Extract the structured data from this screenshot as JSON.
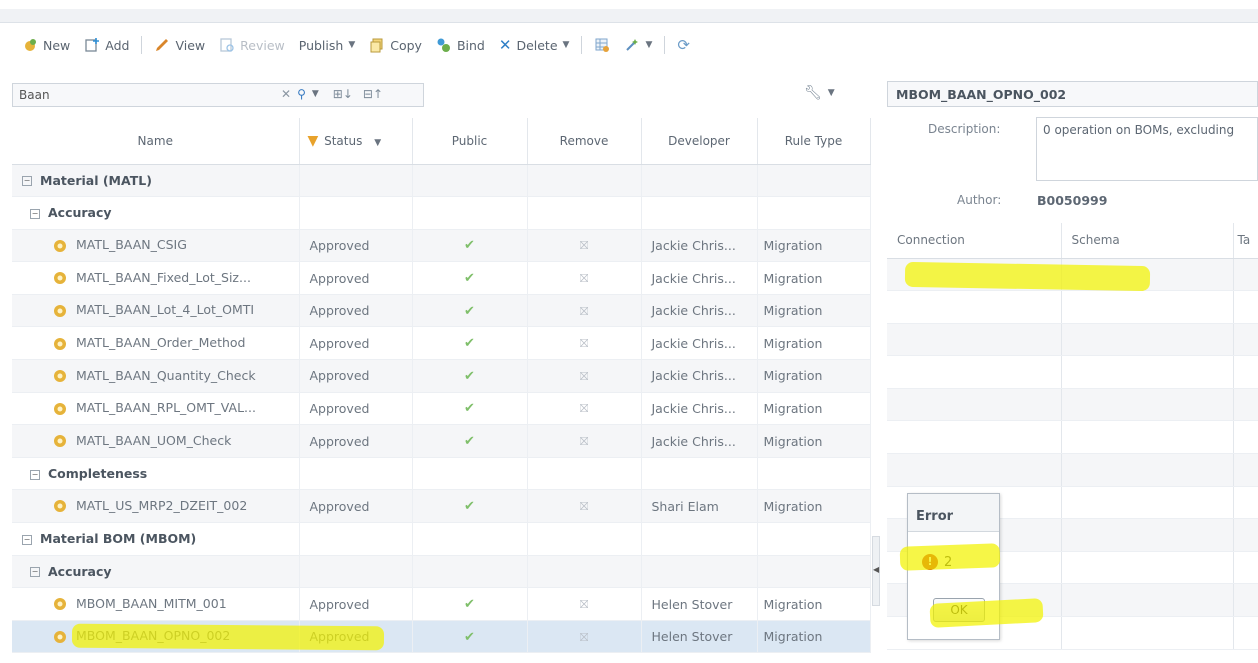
{
  "toolbar": {
    "new": "New",
    "add": "Add",
    "view": "View",
    "review": "Review",
    "publish": "Publish",
    "copy": "Copy",
    "bind": "Bind",
    "delete": "Delete"
  },
  "search": {
    "value": "Baan"
  },
  "grid": {
    "columns": [
      "Name",
      "Status",
      "Public",
      "Remove",
      "Developer",
      "Rule Type"
    ],
    "groups": {
      "g1": "Material (MATL)",
      "g1a": "Accuracy",
      "g1b": "Completeness",
      "g2": "Material BOM (MBOM)",
      "g2a": "Accuracy"
    },
    "rows": [
      {
        "name": "MATL_BAAN_CSIG",
        "status": "Approved",
        "developer": "Jackie Chris...",
        "rule_type": "Migration"
      },
      {
        "name": "MATL_BAAN_Fixed_Lot_Siz...",
        "status": "Approved",
        "developer": "Jackie Chris...",
        "rule_type": "Migration"
      },
      {
        "name": "MATL_BAAN_Lot_4_Lot_OMTI",
        "status": "Approved",
        "developer": "Jackie Chris...",
        "rule_type": "Migration"
      },
      {
        "name": "MATL_BAAN_Order_Method",
        "status": "Approved",
        "developer": "Jackie Chris...",
        "rule_type": "Migration"
      },
      {
        "name": "MATL_BAAN_Quantity_Check",
        "status": "Approved",
        "developer": "Jackie Chris...",
        "rule_type": "Migration"
      },
      {
        "name": "MATL_BAAN_RPL_OMT_VAL...",
        "status": "Approved",
        "developer": "Jackie Chris...",
        "rule_type": "Migration"
      },
      {
        "name": "MATL_BAAN_UOM_Check",
        "status": "Approved",
        "developer": "Jackie Chris...",
        "rule_type": "Migration"
      },
      {
        "name": "MATL_US_MRP2_DZEIT_002",
        "status": "Approved",
        "developer": "Shari Elam",
        "rule_type": "Migration"
      },
      {
        "name": "MBOM_BAAN_MITM_001",
        "status": "Approved",
        "developer": "Helen Stover",
        "rule_type": "Migration"
      },
      {
        "name": "MBOM_BAAN_OPNO_002",
        "status": "Approved",
        "developer": "Helen Stover",
        "rule_type": "Migration"
      }
    ]
  },
  "details": {
    "title": "MBOM_BAAN_OPNO_002",
    "description_label": "Description:",
    "description": "0 operation on BOMs, excluding",
    "author_label": "Author:",
    "author": "B0050999",
    "columns": [
      "Connection",
      "Schema",
      "Ta"
    ]
  },
  "dialog": {
    "title": "Error",
    "message": "2",
    "ok": "OK"
  },
  "colors": {
    "highlight": "#f3f200",
    "error": "#c8231b",
    "check": "#7fbf6a"
  }
}
